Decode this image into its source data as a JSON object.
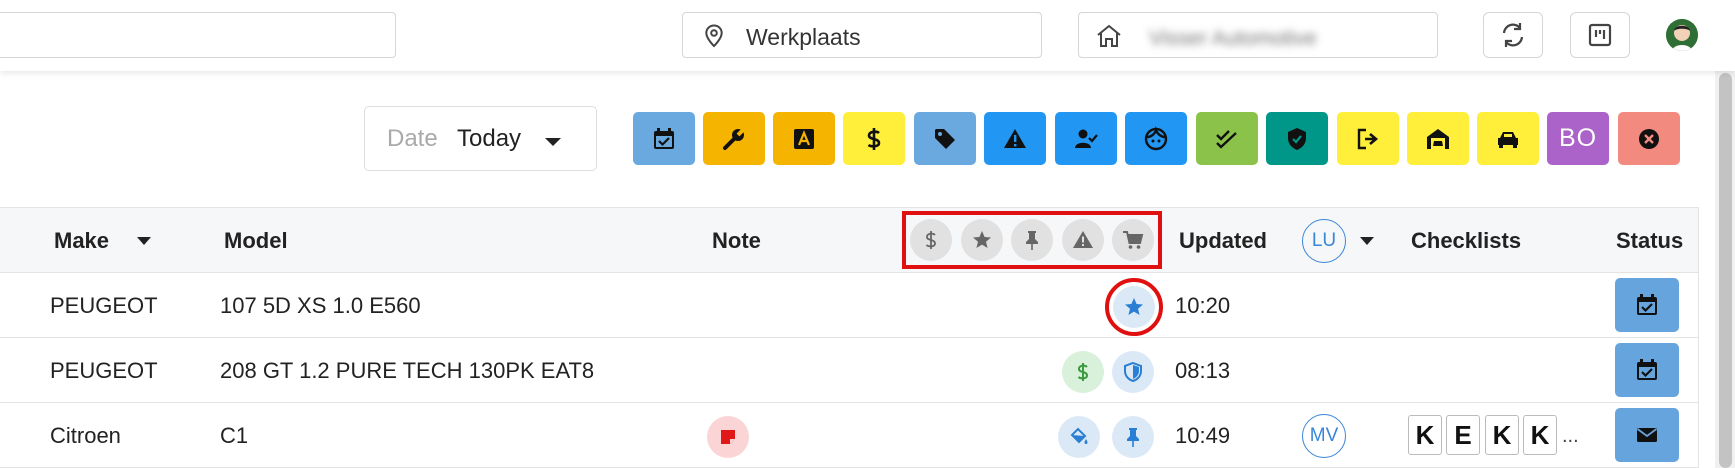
{
  "topbar": {
    "location": "Werkplaats",
    "company": "Visser Automotive"
  },
  "filters": {
    "date_label": "Date",
    "date_value": "Today",
    "bo_label": "BO",
    "status_buttons": [
      {
        "name": "calendar",
        "color": "#6aa9e0"
      },
      {
        "name": "wrench",
        "color": "#f5b400"
      },
      {
        "name": "letter-a",
        "color": "#f5b400"
      },
      {
        "name": "dollar",
        "color": "#ffee3a"
      },
      {
        "name": "tag",
        "color": "#6aa9e0"
      },
      {
        "name": "warning",
        "color": "#2196f3"
      },
      {
        "name": "user-check",
        "color": "#2196f3"
      },
      {
        "name": "face",
        "color": "#2196f3"
      },
      {
        "name": "double-check",
        "color": "#8bc34a"
      },
      {
        "name": "shield",
        "color": "#009688"
      },
      {
        "name": "exit",
        "color": "#ffee3a"
      },
      {
        "name": "garage",
        "color": "#ffee3a"
      },
      {
        "name": "car",
        "color": "#ffee3a"
      },
      {
        "name": "bo",
        "color": "#ab63c9"
      },
      {
        "name": "close",
        "color": "#f28a80"
      }
    ]
  },
  "table": {
    "headers": {
      "make": "Make",
      "model": "Model",
      "note": "Note",
      "updated": "Updated",
      "user_initials": "LU",
      "checklists": "Checklists",
      "status": "Status"
    },
    "rows": [
      {
        "make": "PEUGEOT",
        "model": "107 5D XS 1.0 E560",
        "updated": "10:20",
        "flags": [
          "star"
        ],
        "status_icon": "calendar-icon"
      },
      {
        "make": "PEUGEOT",
        "model": "208 GT 1.2 PURE TECH 130PK EAT8",
        "updated": "08:13",
        "flags": [
          "dollar",
          "shield"
        ],
        "status_icon": "calendar-icon"
      },
      {
        "make": "Citroen",
        "model": "C1",
        "updated": "10:49",
        "flags": [
          "paint-bucket",
          "pin"
        ],
        "user": "MV",
        "checklists": [
          "K",
          "E",
          "K",
          "K"
        ],
        "checklists_more": "...",
        "status_icon": "envelope-icon"
      }
    ]
  }
}
